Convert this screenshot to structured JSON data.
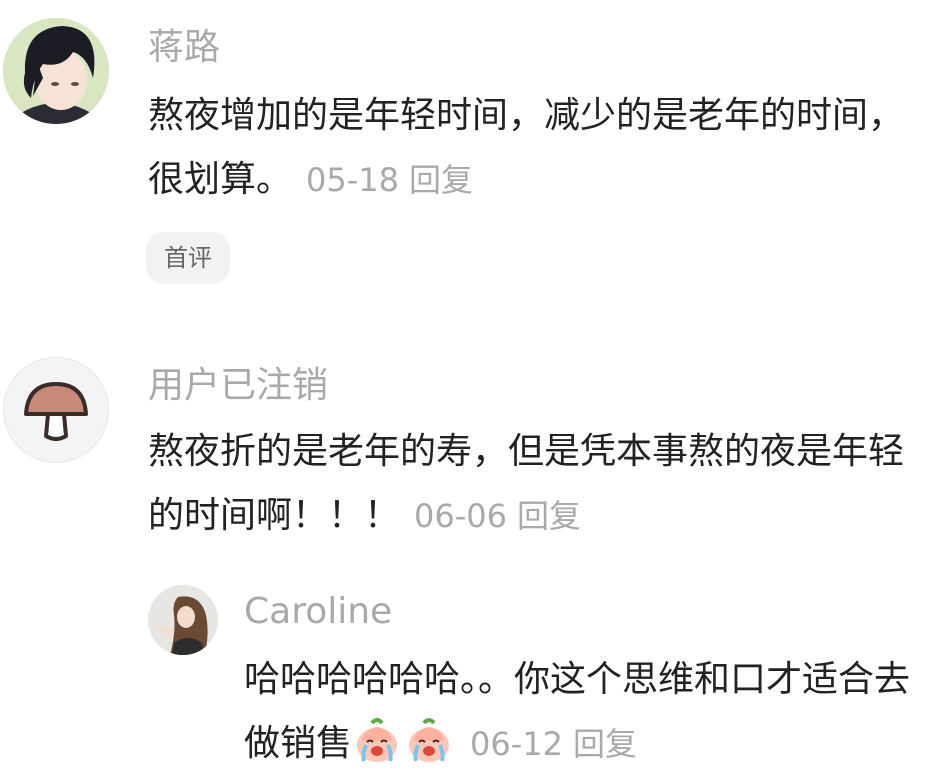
{
  "comments": [
    {
      "username": "蒋路",
      "text": "熬夜增加的是年轻时间，减少的是老年的时间，很划算。",
      "date": "05-18",
      "reply_label": "回复",
      "badge": "首评",
      "avatar_icon": "anime-boy-avatar"
    },
    {
      "username": "用户已注销",
      "text": "熬夜折的是老年的寿，但是凭本事熬的夜是年轻的时间啊！！！",
      "date": "06-06",
      "reply_label": "回复",
      "avatar_icon": "mushroom-icon"
    }
  ],
  "reply": {
    "username": "Caroline",
    "text": "哈哈哈哈哈哈。。你这个思维和口才适合去做销售",
    "date": "06-12",
    "reply_label": "回复",
    "emoji_icon": "crying-peach-emoji",
    "avatar_icon": "woman-photo-avatar"
  },
  "colors": {
    "meta": "#a9a9a9",
    "text": "#222222",
    "badge_bg": "#f2f2f2"
  }
}
